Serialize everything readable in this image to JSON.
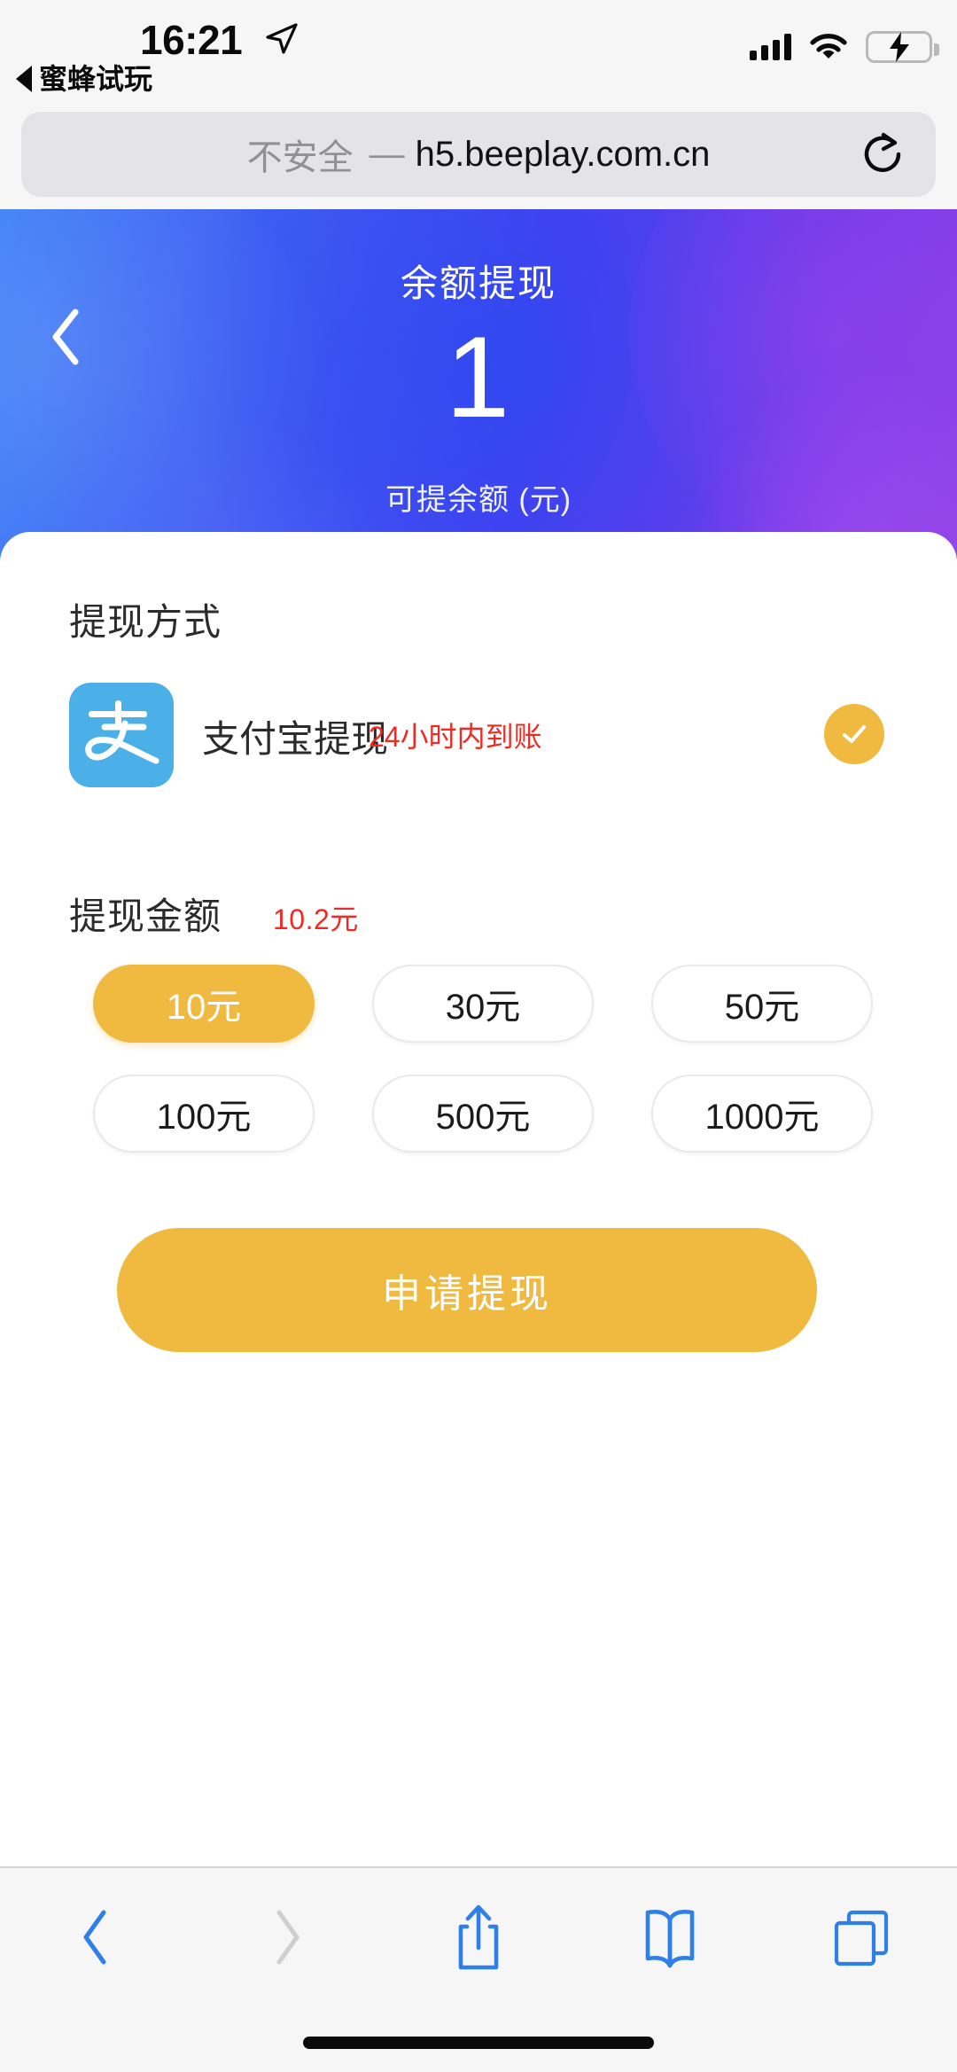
{
  "status_bar": {
    "time": "16:21",
    "location_icon": "location-arrow-icon",
    "back_app_label": "蜜蜂试玩",
    "signal_icon": "cellular-signal-icon",
    "wifi_icon": "wifi-icon",
    "battery_icon": "battery-charging-icon"
  },
  "browser": {
    "url_insecure_label": "不安全",
    "url_separator": "—",
    "url_host": "h5.beeplay.com.cn",
    "reload_icon": "reload-icon",
    "toolbar": {
      "back_label": "back-icon",
      "forward_label": "forward-icon",
      "share_label": "share-icon",
      "bookmarks_label": "bookmarks-icon",
      "tabs_label": "tabs-icon"
    }
  },
  "hero": {
    "back_icon": "chevron-left-icon",
    "title": "余额提现",
    "amount": "1",
    "subtitle": "可提余额 (元)",
    "gradient_from": "#3B7EF7",
    "gradient_to": "#8A3FE6"
  },
  "withdraw": {
    "method_section_title": "提现方式",
    "method": {
      "logo_icon": "alipay-icon",
      "label": "支付宝提现",
      "note": "24小时内到账",
      "selected": true,
      "check_icon": "check-circle-icon",
      "logo_color": "#4BB0E8",
      "note_color": "#EF2A23"
    },
    "amount_section_title": "提现金额",
    "amount_hint": "10.2元",
    "amount_hint_color": "#EF2A23",
    "options": [
      {
        "label": "10元",
        "selected": true
      },
      {
        "label": "30元",
        "selected": false
      },
      {
        "label": "50元",
        "selected": false
      },
      {
        "label": "100元",
        "selected": false
      },
      {
        "label": "500元",
        "selected": false
      },
      {
        "label": "1000元",
        "selected": false
      }
    ],
    "submit_label": "申请提现",
    "accent_color": "#F0B93F"
  }
}
